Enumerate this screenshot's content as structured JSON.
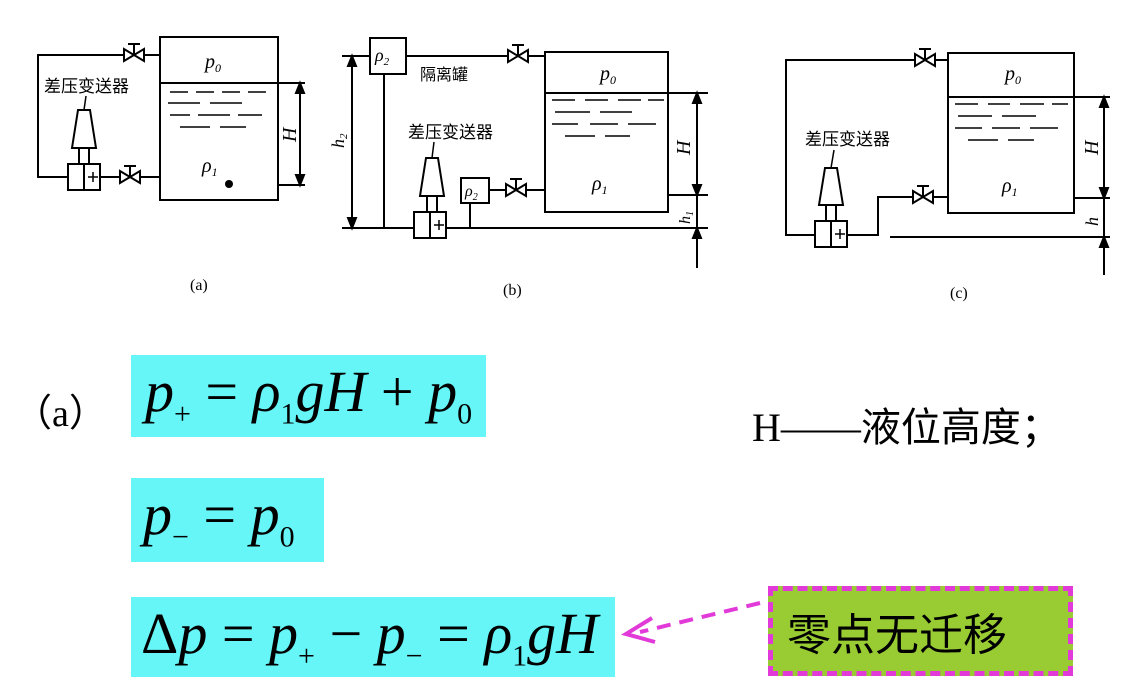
{
  "diagrams": {
    "a": {
      "caption": "(a)",
      "transmitter_label": "差压变送器",
      "p_top": "p",
      "p_top_sub": "0",
      "rho": "ρ",
      "rho_sub": "1",
      "height": "H"
    },
    "b": {
      "caption": "(b)",
      "transmitter_label": "差压变送器",
      "isolator_label": "隔离罐",
      "rho2": "ρ",
      "rho2_sub": "2",
      "p_top": "p",
      "p_top_sub": "0",
      "rho": "ρ",
      "rho_sub": "1",
      "height": "H",
      "h1": "h",
      "h1_sub": "1",
      "h2": "h",
      "h2_sub": "2"
    },
    "c": {
      "caption": "(c)",
      "transmitter_label": "差压变送器",
      "p_top": "p",
      "p_top_sub": "0",
      "rho": "ρ",
      "rho_sub": "1",
      "height": "H",
      "h": "h"
    }
  },
  "case_label": "（a）",
  "equations": {
    "eq1": {
      "lhs": "p",
      "lhs_sub": "+",
      "eq": " = ",
      "rho": "ρ",
      "rho_sub": "1",
      "gH": "gH",
      "plus": " + ",
      "p": "p",
      "p_sub": "0"
    },
    "eq2": {
      "lhs": "p",
      "lhs_sub": "−",
      "eq": " = ",
      "p": "p",
      "p_sub": "0"
    },
    "eq3": {
      "delta": "Δ",
      "p": "p",
      "eq1": " = ",
      "pa": "p",
      "pa_sub": "+",
      "minus": " − ",
      "pb": "p",
      "pb_sub": "−",
      "eq2": " = ",
      "rho": "ρ",
      "rho_sub": "1",
      "gH": "gH"
    }
  },
  "note": {
    "symbol": "H",
    "dash": "——",
    "text": "液位高度；"
  },
  "zero_label": "零点无迁移",
  "colors": {
    "equation_bg": "#66f6f8",
    "zero_bg": "#99cc33",
    "zero_border": "#e23ad8"
  }
}
